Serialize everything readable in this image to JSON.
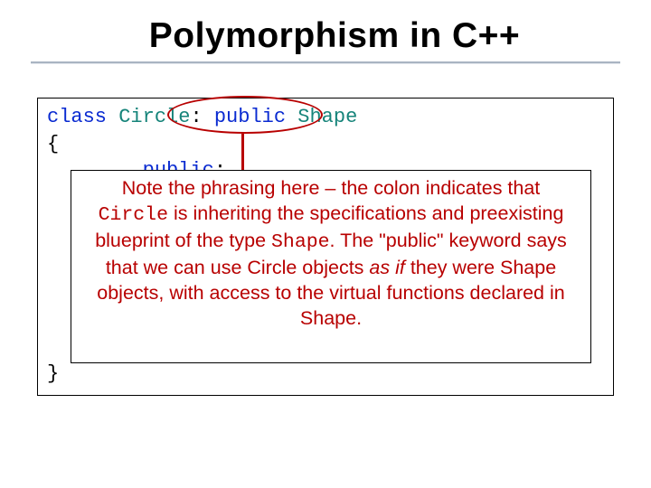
{
  "title": "Polymorphism in C++",
  "code": {
    "kw_class": "class",
    "type_circle": "Circle",
    "colon_sp": ": ",
    "kw_public_inh": "public",
    "sp": " ",
    "type_shape": "Shape",
    "open_brace": "{",
    "indent": "        ",
    "kw_public_sect": "public",
    "sect_colon": ":",
    "close_brace": "}"
  },
  "note": {
    "p1a": "Note the phrasing here – the colon indicates that ",
    "p1_code1": "Circle",
    "p1b": " is inheriting the specifications and preexisting blueprint of the type ",
    "p1_code2": "Shape",
    "p1c": ". The \"public\" keyword says that we can use Circle objects ",
    "p1_ital": "as if",
    "p1d": " they were Shape objects, with access to the virtual functions declared in Shape."
  }
}
